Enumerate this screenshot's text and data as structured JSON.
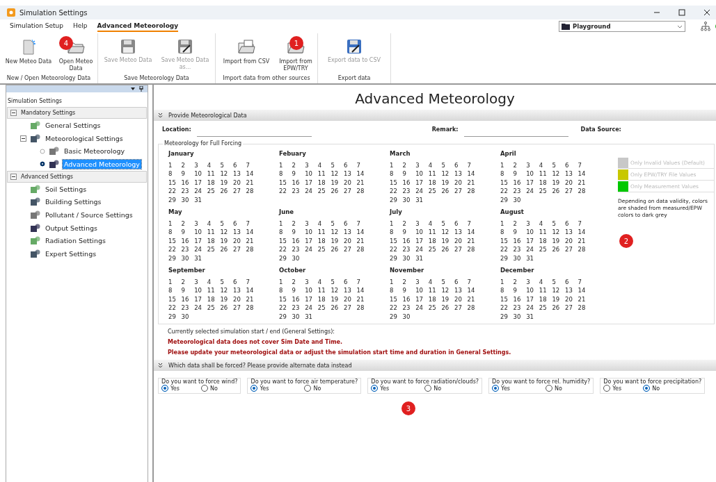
{
  "window": {
    "title": "Simulation Settings"
  },
  "menu": [
    {
      "label": "Simulation Setup",
      "selected": false
    },
    {
      "label": "Help",
      "selected": false
    },
    {
      "label": "Advanced Meteorology",
      "selected": true
    }
  ],
  "project": {
    "value": "Playground"
  },
  "ribbon": [
    {
      "label": "New / Open Meteorology Data",
      "buttons": [
        {
          "label": "New Meteo Data",
          "disabled": false
        },
        {
          "label": "Open Meteo Data",
          "disabled": false
        }
      ]
    },
    {
      "label": "Save Meteorology Data",
      "buttons": [
        {
          "label": "Save Meteo Data",
          "disabled": true
        },
        {
          "label": "Save Meteo Data as...",
          "disabled": true
        }
      ]
    },
    {
      "label": "Import data from other sources",
      "buttons": [
        {
          "label": "Import from CSV",
          "disabled": false
        },
        {
          "label": "Import from EPW/TRY",
          "disabled": false
        }
      ]
    },
    {
      "label": "Export data",
      "buttons": [
        {
          "label": "Export data to CSV",
          "disabled": true
        }
      ]
    }
  ],
  "sidebar": {
    "title": "Simulation Settings",
    "groups": [
      {
        "label": "Mandatory Settings",
        "expanded": true,
        "children": [
          {
            "label": "General Settings",
            "selected": false
          },
          {
            "label": "Meteorological Settings",
            "selected": false,
            "expanded": true,
            "children": [
              {
                "label": "Basic Meteorology",
                "selected": false
              },
              {
                "label": "Advanced Meteorology",
                "selected": true
              }
            ]
          }
        ]
      },
      {
        "label": "Advanced Settings",
        "expanded": true,
        "children": [
          {
            "label": "Soil Settings",
            "selected": false
          },
          {
            "label": "Building Settings",
            "selected": false
          },
          {
            "label": "Pollutant / Source Settings",
            "selected": false
          },
          {
            "label": "Output Settings",
            "selected": false
          },
          {
            "label": "Radiation Settings",
            "selected": false
          },
          {
            "label": "Expert Settings",
            "selected": false
          }
        ]
      }
    ]
  },
  "heading": "Advanced Meteorology",
  "data_section": {
    "title": "Provide Meteorological Data",
    "fields": [
      {
        "label": "Location:"
      },
      {
        "label": "Remark:"
      },
      {
        "label": "Data Source:"
      }
    ],
    "calendar_title": "Meteorology for Full Forcing",
    "months": [
      {
        "name": "January",
        "days": [
          "1",
          "2",
          "3",
          "4",
          "5",
          "6",
          "7",
          "8",
          "9",
          "10",
          "11",
          "12",
          "13",
          "14",
          "15",
          "16",
          "17",
          "18",
          "19",
          "20",
          "21",
          "22",
          "23",
          "24",
          "25",
          "26",
          "27",
          "28",
          "29",
          "30",
          "31"
        ]
      },
      {
        "name": "Febuary",
        "days": [
          "1",
          "2",
          "3",
          "4",
          "5",
          "6",
          "7",
          "8",
          "9",
          "10",
          "11",
          "12",
          "13",
          "14",
          "15",
          "16",
          "17",
          "18",
          "19",
          "20",
          "21",
          "22",
          "23",
          "24",
          "25",
          "26",
          "27",
          "28"
        ]
      },
      {
        "name": "March",
        "days": [
          "1",
          "2",
          "3",
          "4",
          "5",
          "6",
          "7",
          "8",
          "9",
          "10",
          "11",
          "12",
          "13",
          "14",
          "15",
          "16",
          "17",
          "18",
          "19",
          "20",
          "21",
          "22",
          "23",
          "24",
          "25",
          "26",
          "27",
          "28",
          "29",
          "30",
          "31"
        ]
      },
      {
        "name": "April",
        "days": [
          "1",
          "2",
          "3",
          "4",
          "5",
          "6",
          "7",
          "8",
          "9",
          "10",
          "11",
          "12",
          "13",
          "14",
          "15",
          "16",
          "17",
          "18",
          "19",
          "20",
          "21",
          "22",
          "23",
          "24",
          "25",
          "26",
          "27",
          "28",
          "29",
          "30"
        ]
      },
      {
        "name": "May",
        "days": [
          "1",
          "2",
          "3",
          "4",
          "5",
          "6",
          "7",
          "8",
          "9",
          "10",
          "11",
          "12",
          "13",
          "14",
          "15",
          "16",
          "17",
          "18",
          "19",
          "20",
          "21",
          "22",
          "23",
          "24",
          "25",
          "26",
          "27",
          "28",
          "29",
          "30",
          "31"
        ]
      },
      {
        "name": "June",
        "days": [
          "1",
          "2",
          "3",
          "4",
          "5",
          "6",
          "7",
          "8",
          "9",
          "10",
          "11",
          "12",
          "13",
          "14",
          "15",
          "16",
          "17",
          "18",
          "19",
          "20",
          "21",
          "22",
          "23",
          "24",
          "25",
          "26",
          "27",
          "28",
          "29",
          "30"
        ]
      },
      {
        "name": "July",
        "days": [
          "1",
          "2",
          "3",
          "4",
          "5",
          "6",
          "7",
          "8",
          "9",
          "10",
          "11",
          "12",
          "13",
          "14",
          "15",
          "16",
          "17",
          "18",
          "19",
          "20",
          "21",
          "22",
          "23",
          "24",
          "25",
          "26",
          "27",
          "28",
          "29",
          "30",
          "31"
        ]
      },
      {
        "name": "August",
        "days": [
          "1",
          "2",
          "3",
          "4",
          "5",
          "6",
          "7",
          "8",
          "9",
          "10",
          "11",
          "12",
          "13",
          "14",
          "15",
          "16",
          "17",
          "18",
          "19",
          "20",
          "21",
          "22",
          "23",
          "24",
          "25",
          "26",
          "27",
          "28",
          "29",
          "30",
          "31"
        ]
      },
      {
        "name": "September",
        "days": [
          "1",
          "2",
          "3",
          "4",
          "5",
          "6",
          "7",
          "8",
          "9",
          "10",
          "11",
          "12",
          "13",
          "14",
          "15",
          "16",
          "17",
          "18",
          "19",
          "20",
          "21",
          "22",
          "23",
          "24",
          "25",
          "26",
          "27",
          "28",
          "29",
          "30"
        ]
      },
      {
        "name": "October",
        "days": [
          "1",
          "2",
          "3",
          "4",
          "5",
          "6",
          "7",
          "8",
          "9",
          "10",
          "11",
          "12",
          "13",
          "14",
          "15",
          "16",
          "17",
          "18",
          "19",
          "20",
          "21",
          "22",
          "23",
          "24",
          "25",
          "26",
          "27",
          "28",
          "29",
          "30",
          "31"
        ]
      },
      {
        "name": "November",
        "days": [
          "1",
          "2",
          "3",
          "4",
          "5",
          "6",
          "7",
          "8",
          "9",
          "10",
          "11",
          "12",
          "13",
          "14",
          "15",
          "16",
          "17",
          "18",
          "19",
          "20",
          "21",
          "22",
          "23",
          "24",
          "25",
          "26",
          "27",
          "28",
          "29",
          "30"
        ]
      },
      {
        "name": "December",
        "days": [
          "1",
          "2",
          "3",
          "4",
          "5",
          "6",
          "7",
          "8",
          "9",
          "10",
          "11",
          "12",
          "13",
          "14",
          "15",
          "16",
          "17",
          "18",
          "19",
          "20",
          "21",
          "22",
          "23",
          "24",
          "25",
          "26",
          "27",
          "28",
          "29",
          "30",
          "31"
        ]
      }
    ],
    "legend": [
      {
        "label": "Only Invalid Values (Default)",
        "color": "#c8c8c8"
      },
      {
        "label": "Only EPW/TRY File Values",
        "color": "#c8c800"
      },
      {
        "label": "Only Measurement Values",
        "color": "#00c800"
      }
    ],
    "legend_note": "Depending on data validity, colors are shaded from measured/EPW colors to dark grey",
    "status": [
      {
        "text": "Currently selected simulation start / end (General Settings):",
        "kind": "info"
      },
      {
        "text": "Meteorological data does not cover Sim Date and Time.",
        "kind": "error"
      },
      {
        "text": "Please update your meteorological data or adjust the simulation start time and duration in General Settings.",
        "kind": "error"
      }
    ]
  },
  "force_section": {
    "title": "Which data shall be forced? Please provide alternate data instead",
    "questions": [
      {
        "label": "Do you want to force wind?",
        "options": [
          {
            "label": "Yes",
            "selected": true
          },
          {
            "label": "No",
            "selected": false
          }
        ]
      },
      {
        "label": "Do you want to force air temperature?",
        "options": [
          {
            "label": "Yes",
            "selected": true
          },
          {
            "label": "No",
            "selected": false
          }
        ]
      },
      {
        "label": "Do you want to force radiation/clouds?",
        "options": [
          {
            "label": "Yes",
            "selected": true
          },
          {
            "label": "No",
            "selected": false
          }
        ]
      },
      {
        "label": "Do you want to force rel. humidity?",
        "options": [
          {
            "label": "Yes",
            "selected": true
          },
          {
            "label": "No",
            "selected": false
          }
        ]
      },
      {
        "label": "Do you want to force precipitation?",
        "options": [
          {
            "label": "Yes",
            "selected": false
          },
          {
            "label": "No",
            "selected": true
          }
        ]
      }
    ]
  },
  "markers": [
    "1",
    "2",
    "3",
    "4"
  ]
}
